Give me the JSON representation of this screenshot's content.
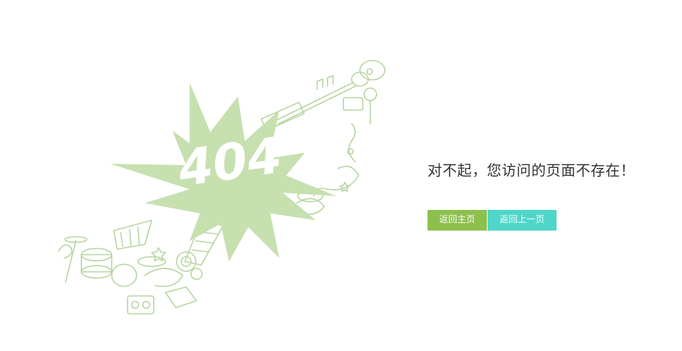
{
  "illustration": {
    "code_text": "404",
    "color": "#c6e0b0",
    "outline_color": "#b3d49b"
  },
  "message": {
    "text": "对不起，您访问的页面不存在！"
  },
  "buttons": {
    "home_label": "返回主页",
    "back_label": "返回上一页",
    "home_color": "#8cc04c",
    "back_color": "#4fd6c8"
  }
}
